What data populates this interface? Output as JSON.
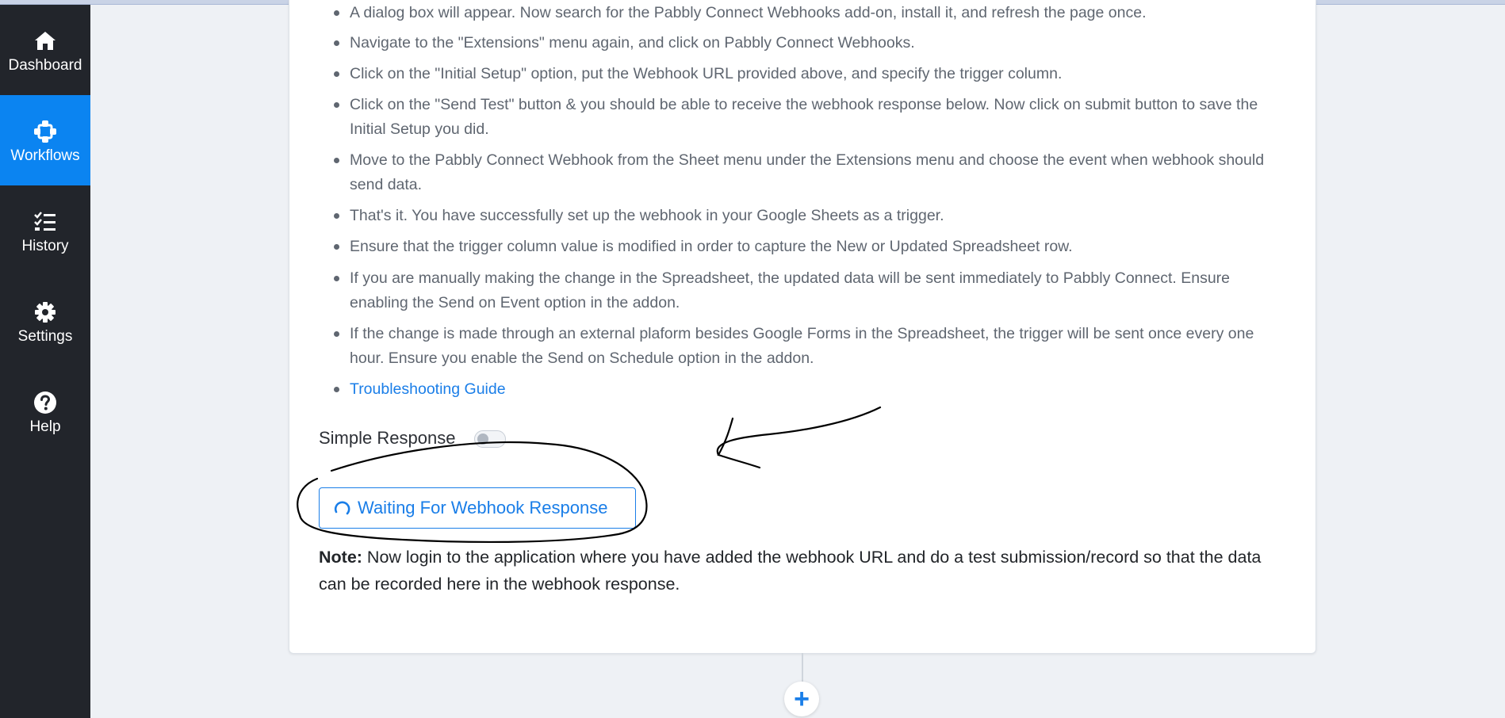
{
  "sidebar": {
    "items": [
      {
        "label": "Dashboard",
        "icon": "home-icon",
        "active": false
      },
      {
        "label": "Workflows",
        "icon": "workflow-icon",
        "active": true
      },
      {
        "label": "History",
        "icon": "checklist-icon",
        "active": false
      },
      {
        "label": "Settings",
        "icon": "gear-icon",
        "active": false
      },
      {
        "label": "Help",
        "icon": "help-icon",
        "active": false
      }
    ]
  },
  "instructions": {
    "steps": [
      "A dialog box will appear. Now search for the Pabbly Connect Webhooks add-on, install it, and refresh the page once.",
      "Navigate to the \"Extensions\" menu again, and click on Pabbly Connect Webhooks.",
      "Click on the \"Initial Setup\" option, put the Webhook URL provided above, and specify the trigger column.",
      "Click on the \"Send Test\" button & you should be able to receive the webhook response below. Now click on submit button to save the Initial Setup you did.",
      "Move to the Pabbly Connect Webhook from the Sheet menu under the Extensions menu and choose the event when webhook should send data.",
      "That's it. You have successfully set up the webhook in your Google Sheets as a trigger.",
      "Ensure that the trigger column value is modified in order to capture the New or Updated Spreadsheet row.",
      "If you are manually making the change in the Spreadsheet, the updated data will be sent immediately to Pabbly Connect. Ensure enabling the Send on Event option in the addon.",
      "If the change is made through an external plaform besides Google Forms in the Spreadsheet, the trigger will be sent once every one hour. Ensure you enable the Send on Schedule option in the addon."
    ],
    "troubleshooting_link": "Troubleshooting Guide"
  },
  "simple_response": {
    "label": "Simple Response",
    "enabled": false
  },
  "waiting_button": {
    "label": "Waiting For Webhook Response",
    "icon": "spinner-icon"
  },
  "note": {
    "prefix": "Note:",
    "text": " Now login to the application where you have added the webhook URL and do a test submission/record so that the data can be recorded here in the webhook response."
  },
  "add_step": {
    "icon": "plus-icon",
    "label": "+"
  },
  "colors": {
    "accent": "#1a7ee8",
    "sidebar_bg": "#22252b",
    "active_nav": "#0b84f1"
  }
}
